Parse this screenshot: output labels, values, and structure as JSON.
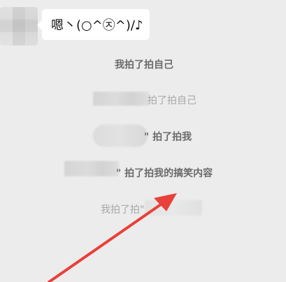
{
  "message": {
    "bubble_text": "嗯丶(○^㉨^)/♪"
  },
  "system_notices": [
    {
      "text": "我拍了拍自己"
    },
    {
      "text": "拍了拍自己"
    },
    {
      "text": "\" 拍了拍我"
    },
    {
      "text": "\" 拍了拍我的搞笑内容"
    },
    {
      "text": "我拍了拍\""
    }
  ],
  "annotation": {
    "arrow_color": "#e8403a"
  }
}
